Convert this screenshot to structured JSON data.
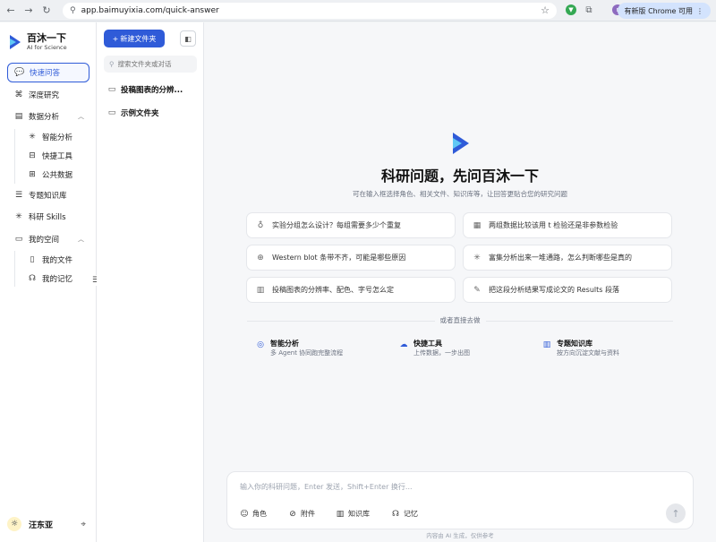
{
  "browser": {
    "url": "app.baimuyixia.com/quick-answer",
    "chrome_update": "有新版 Chrome 可用",
    "profile_initial": "r"
  },
  "brand": {
    "name": "百沐一下",
    "tagline": "AI for Science",
    "accent": "#2f5bd8"
  },
  "sidebar": {
    "items": [
      {
        "label": "快速问答",
        "icon": "chat-bubbles-icon"
      },
      {
        "label": "深度研究",
        "icon": "grid-icon"
      },
      {
        "label": "数据分析",
        "icon": "chart-icon"
      },
      {
        "label": "智能分析",
        "icon": "sparkle-icon"
      },
      {
        "label": "快捷工具",
        "icon": "toolbox-icon"
      },
      {
        "label": "公共数据",
        "icon": "database-icon"
      },
      {
        "label": "专题知识库",
        "icon": "layers-icon"
      },
      {
        "label": "科研 Skills",
        "icon": "sparkle-icon"
      },
      {
        "label": "我的空间",
        "icon": "folder-icon"
      },
      {
        "label": "我的文件",
        "icon": "file-icon"
      },
      {
        "label": "我的记忆",
        "icon": "memory-icon"
      }
    ],
    "user_name": "汪东亚"
  },
  "folders": {
    "new_folder_label": "新建文件夹",
    "search_placeholder": "搜索文件夹或对话",
    "items": [
      "投稿图表的分辨...",
      "示例文件夹"
    ]
  },
  "main": {
    "title": "科研问题，先问百沐一下",
    "subtitle": "可在输入框选择角色、相关文件、知识库等，让回答更贴合您的研究问题",
    "suggestions": [
      "实验分组怎么设计？每组需要多少个重复",
      "两组数据比较该用 t 检验还是非参数检验",
      "Western blot 条带不齐，可能是哪些原因",
      "富集分析出来一堆通路，怎么判断哪些是真的",
      "投稿图表的分辨率、配色、字号怎么定",
      "把这段分析结果写成论文的 Results 段落"
    ],
    "divider_text": "或者直接去做",
    "quick_links": [
      {
        "title": "智能分析",
        "desc": "多 Agent 协同跑完整流程"
      },
      {
        "title": "快捷工具",
        "desc": "上传数据，一步出图"
      },
      {
        "title": "专题知识库",
        "desc": "按方向沉淀文献与资料"
      }
    ],
    "composer_placeholder": "输入你的科研问题，Enter 发送，Shift+Enter 换行...",
    "tools": [
      "角色",
      "附件",
      "知识库",
      "记忆"
    ],
    "disclaimer": "内容由 AI 生成，仅供参考"
  }
}
